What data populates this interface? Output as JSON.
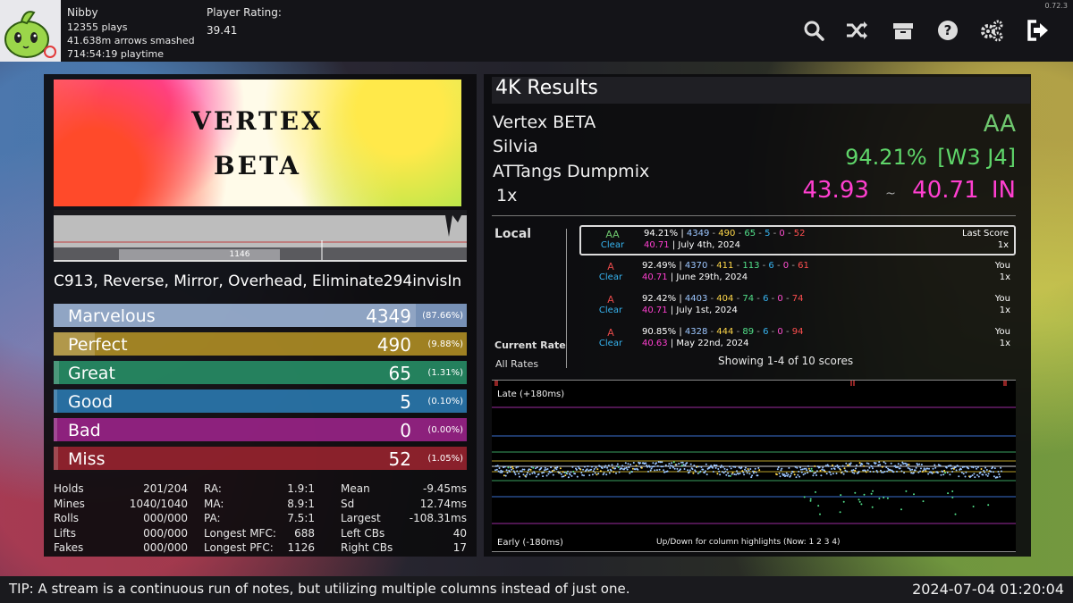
{
  "version": "0.72.3",
  "profile": {
    "name": "Nibby",
    "plays": "12355 plays",
    "arrows": "41.638m arrows smashed",
    "playtime": "714:54:19 playtime",
    "rating_label": "Player Rating:",
    "rating_value": "39.41"
  },
  "toolbar_icons": [
    "search-icon",
    "shuffle-icon",
    "box-icon",
    "help-icon",
    "settings-icon",
    "exit-icon"
  ],
  "banner": {
    "line1": "VERTEX",
    "line2": "BETA"
  },
  "density": {
    "label": "1146"
  },
  "mods": "C913, Reverse, Mirror, Overhead, Eliminate294invisIn",
  "judgments": [
    {
      "name": "Marvelous",
      "count": "4349",
      "pct": "(87.66%)",
      "color": "#8aa8d4",
      "fill": 0.8766
    },
    {
      "name": "Perfect",
      "count": "490",
      "pct": "(9.88%)",
      "color": "#b99526",
      "fill": 0.0988
    },
    {
      "name": "Great",
      "count": "65",
      "pct": "(1.31%)",
      "color": "#28956b",
      "fill": 0.0131
    },
    {
      "name": "Good",
      "count": "5",
      "pct": "(0.10%)",
      "color": "#2b7fb8",
      "fill": 0.001
    },
    {
      "name": "Bad",
      "count": "0",
      "pct": "(0.00%)",
      "color": "#a2248f",
      "fill": 0.0
    },
    {
      "name": "Miss",
      "count": "52",
      "pct": "(1.05%)",
      "color": "#a02430",
      "fill": 0.0105
    }
  ],
  "stats_left": [
    {
      "label": "Holds",
      "value": "201/204"
    },
    {
      "label": "Mines",
      "value": "1040/1040"
    },
    {
      "label": "Rolls",
      "value": "000/000"
    },
    {
      "label": "Lifts",
      "value": "000/000"
    },
    {
      "label": "Fakes",
      "value": "000/000"
    }
  ],
  "stats_mid": [
    {
      "label": "RA:",
      "value": "1.9:1"
    },
    {
      "label": "MA:",
      "value": "8.9:1"
    },
    {
      "label": "PA:",
      "value": "7.5:1"
    },
    {
      "label": "Longest MFC:",
      "value": "688"
    },
    {
      "label": "Longest PFC:",
      "value": "1126"
    }
  ],
  "stats_right": [
    {
      "label": "Mean",
      "value": "-9.45ms"
    },
    {
      "label": "Sd",
      "value": "12.74ms"
    },
    {
      "label": "Largest",
      "value": "-108.31ms"
    },
    {
      "label": "Left CBs",
      "value": "40"
    },
    {
      "label": "Right CBs",
      "value": "17"
    }
  ],
  "results": {
    "title": "4K Results",
    "song": "Vertex BETA",
    "artist": "Silvia",
    "chart": "ATTangs Dumpmix",
    "rate": "1x",
    "grade": "AA",
    "percent": "94.21%",
    "judge": "[W3 J4]",
    "msd": "43.93",
    "tilde": "~",
    "ssr": "40.71",
    "ssr_suffix": "IN"
  },
  "scoreboard": {
    "local_label": "Local",
    "current_rate_label": "Current Rate",
    "all_rates_label": "All Rates",
    "showing": "Showing 1-4 of 10 scores",
    "entries": [
      {
        "grade": "AA",
        "grade_color": "#6fc86f",
        "clear": "Clear",
        "pct": "94.21%",
        "j": [
          "4349",
          "490",
          "65",
          "5",
          "0",
          "52"
        ],
        "ssr": "40.71",
        "date": "July 4th, 2024",
        "tag": "Last Score",
        "rate": "1x"
      },
      {
        "grade": "A",
        "grade_color": "#e84a4a",
        "clear": "Clear",
        "pct": "92.49%",
        "j": [
          "4370",
          "411",
          "113",
          "6",
          "0",
          "61"
        ],
        "ssr": "40.71",
        "date": "June 29th, 2024",
        "tag": "You",
        "rate": "1x"
      },
      {
        "grade": "A",
        "grade_color": "#e84a4a",
        "clear": "Clear",
        "pct": "92.42%",
        "j": [
          "4403",
          "404",
          "74",
          "6",
          "0",
          "74"
        ],
        "ssr": "40.71",
        "date": "July 1st, 2024",
        "tag": "You",
        "rate": "1x"
      },
      {
        "grade": "A",
        "grade_color": "#e84a4a",
        "clear": "Clear",
        "pct": "90.85%",
        "j": [
          "4328",
          "444",
          "89",
          "6",
          "0",
          "94"
        ],
        "ssr": "40.63",
        "date": "May 22nd, 2024",
        "tag": "You",
        "rate": "1x"
      }
    ]
  },
  "offset_plot": {
    "late_label": "Late (+180ms)",
    "early_label": "Early (-180ms)",
    "hint": "Up/Down for column highlights (Now: 1 2 3 4)"
  },
  "footer": {
    "tip": "TIP: A stream is a continuous run of notes, but utilizing multiple columns instead of just one.",
    "clock": "2024-07-04 01:20:04"
  }
}
